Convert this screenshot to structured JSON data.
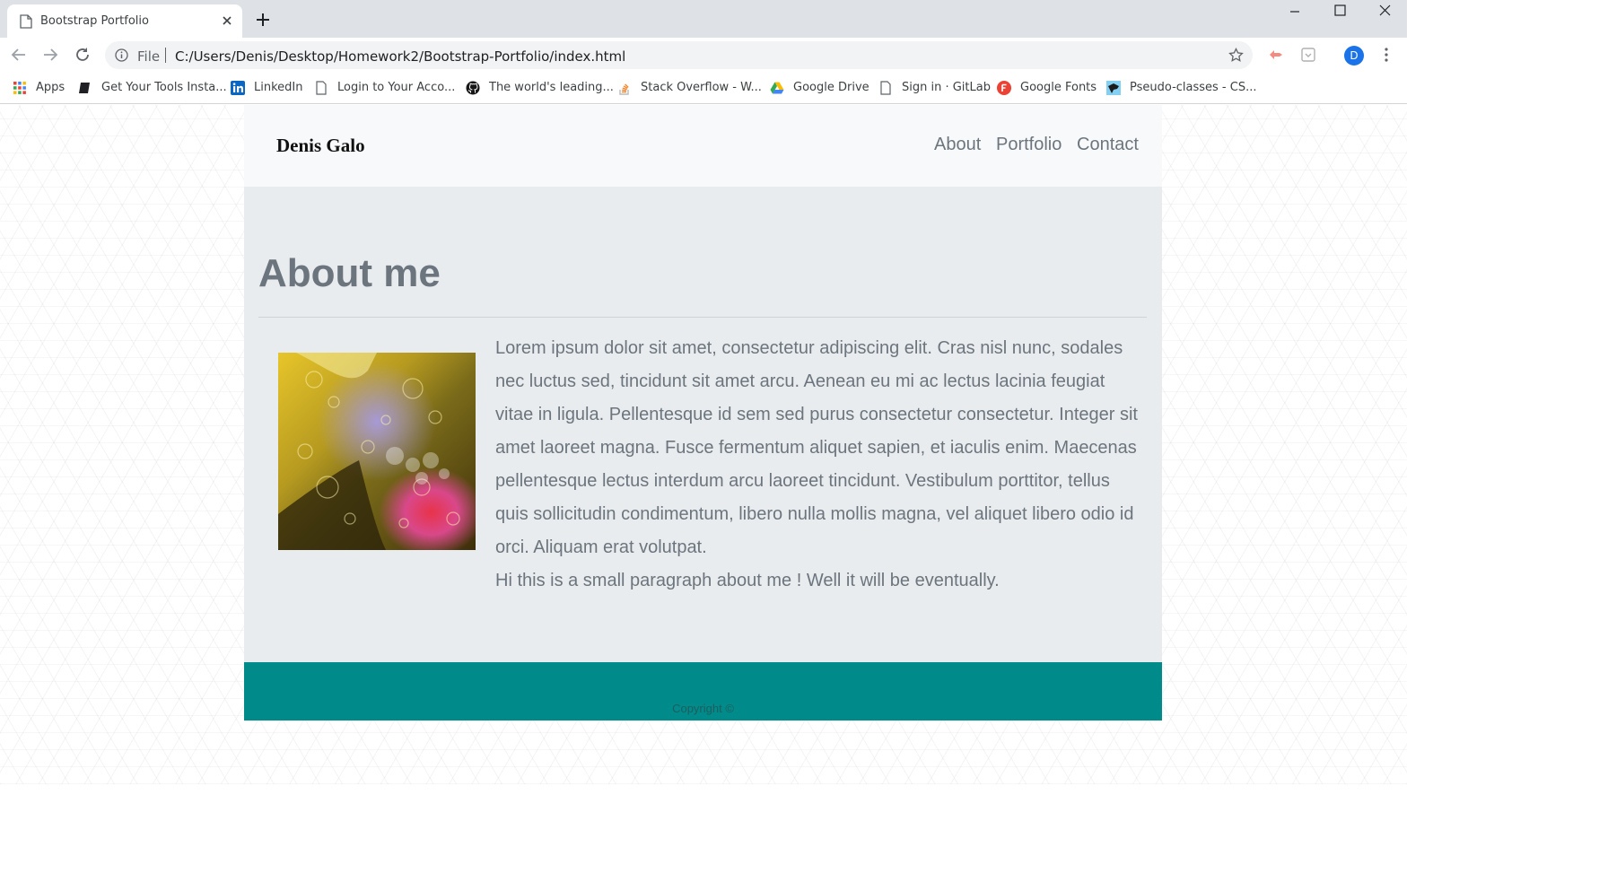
{
  "browser": {
    "tab_title": "Bootstrap Portfolio",
    "url_scheme": "File",
    "url": "C:/Users/Denis/Desktop/Homework2/Bootstrap-Portfolio/index.html",
    "profile_initial": "D"
  },
  "bookmarks": [
    {
      "label": "Apps",
      "icon": "apps-grid-icon"
    },
    {
      "label": "Get Your Tools Insta...",
      "icon": "book-icon"
    },
    {
      "label": "LinkedIn",
      "icon": "linkedin-icon"
    },
    {
      "label": "Login to Your Acco...",
      "icon": "page-icon"
    },
    {
      "label": "The world's leading...",
      "icon": "github-icon"
    },
    {
      "label": "Stack Overflow - W...",
      "icon": "stackoverflow-icon"
    },
    {
      "label": "Google Drive",
      "icon": "google-drive-icon"
    },
    {
      "label": "Sign in · GitLab",
      "icon": "page-icon"
    },
    {
      "label": "Google Fonts",
      "icon": "google-fonts-icon"
    },
    {
      "label": "Pseudo-classes - CS...",
      "icon": "mdn-icon"
    }
  ],
  "site": {
    "brand": "Denis Galo",
    "nav": [
      "About",
      "Portfolio",
      "Contact"
    ],
    "heading": "About me",
    "paragraph": "Lorem ipsum dolor sit amet, consectetur adipiscing elit. Cras nisl nunc, sodales nec luctus sed, tincidunt sit amet arcu. Aenean eu mi ac lectus lacinia feugiat vitae in ligula. Pellentesque id sem sed purus consectetur consectetur. Integer sit amet laoreet magna. Fusce fermentum aliquet sapien, et iaculis enim. Maecenas pellentesque lectus interdum arcu laoreet tincidunt. Vestibulum porttitor, tellus quis sollicitudin condimentum, libero nulla mollis magna, vel aliquet libero odio id orci. Aliquam erat volutpat.",
    "paragraph2": "Hi this is a small paragraph about me ! Well it will be eventually.",
    "footer": "Copyright ©"
  },
  "colors": {
    "footer_bg": "#008b8b",
    "jumbotron_bg": "#e9ecef",
    "navbar_bg": "#f8f9fa",
    "text_muted": "#6c757d"
  }
}
